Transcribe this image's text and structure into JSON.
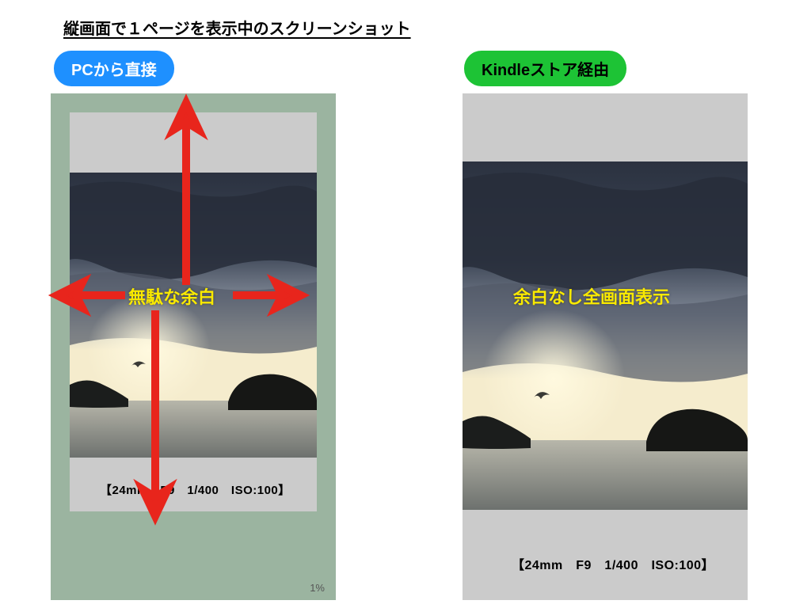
{
  "title": "縦画面で１ページを表示中のスクリーンショット",
  "badges": {
    "left": "PCから直接",
    "right": "Kindleストア経由"
  },
  "overlays": {
    "left": "無駄な余白",
    "right": "余白なし全画面表示"
  },
  "photo_meta": "【24mm　F9　1/400　ISO:100】",
  "left_progress": "1%",
  "colors": {
    "badge_blue": "#1E90FF",
    "badge_green": "#1DC335",
    "arrow_red": "#E8251C",
    "sage": "#9BB4A0",
    "gray": "#CBCBCB",
    "overlay_yellow": "#F9E900"
  }
}
